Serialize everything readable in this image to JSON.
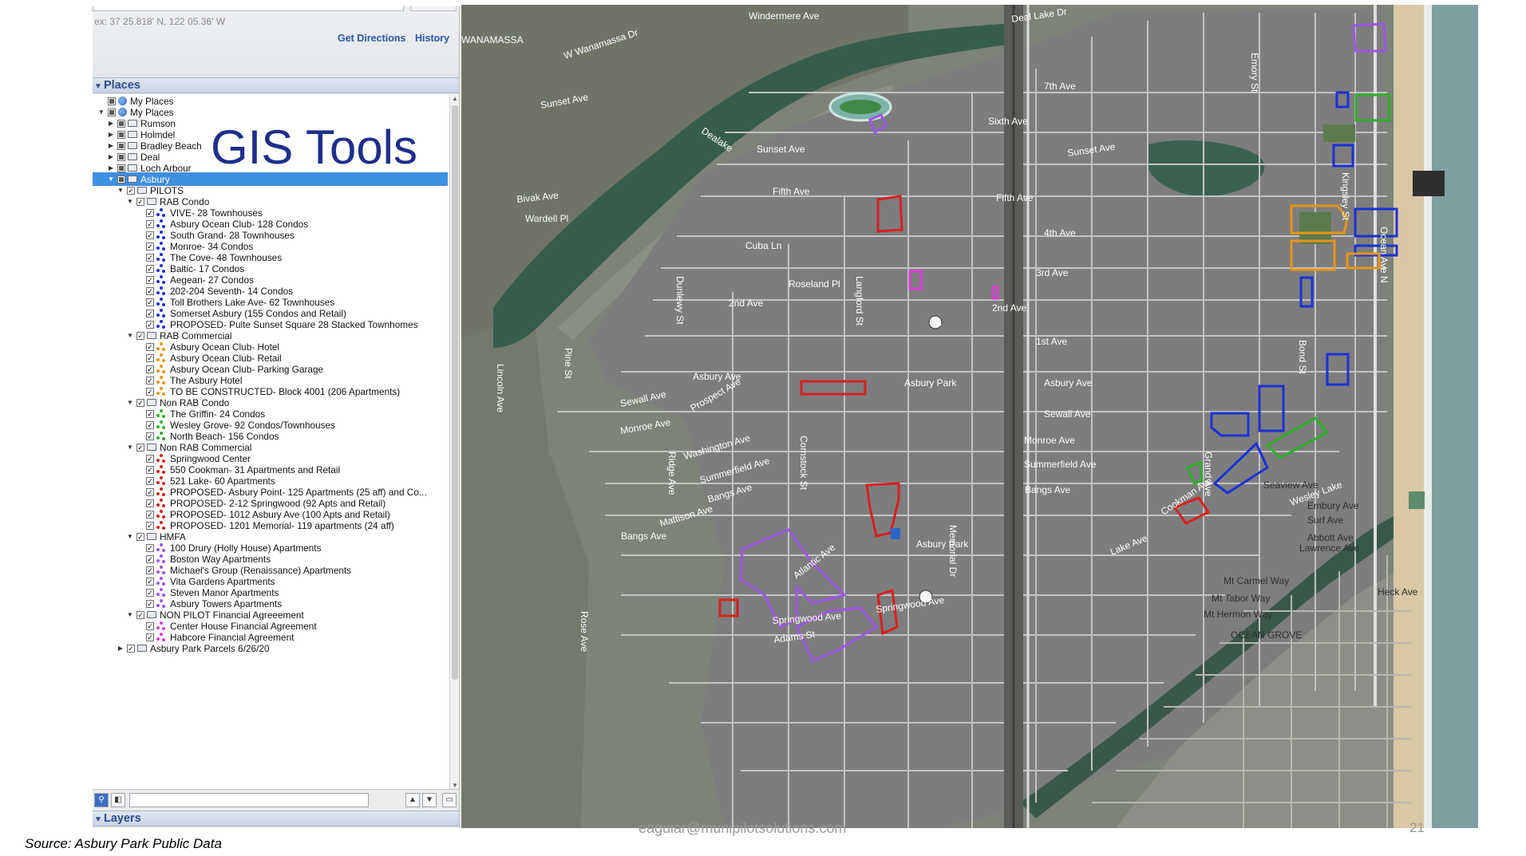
{
  "search": {
    "coords": "ex: 37 25.818' N, 122 05.36' W",
    "get_directions": "Get Directions",
    "history": "History"
  },
  "places": {
    "header": "Places",
    "items": [
      {
        "label": "My Places",
        "depth": 1,
        "icon": "globe",
        "expander": ""
      },
      {
        "label": "My Places",
        "depth": 1,
        "icon": "globe",
        "expander": "▼"
      },
      {
        "label": "Rumson",
        "depth": 2,
        "icon": "folder",
        "expander": "▶"
      },
      {
        "label": "Holmdel",
        "depth": 2,
        "icon": "folder",
        "expander": "▶"
      },
      {
        "label": "Bradley Beach",
        "depth": 2,
        "icon": "folder",
        "expander": "▶"
      },
      {
        "label": "Deal",
        "depth": 2,
        "icon": "folder",
        "expander": "▶"
      },
      {
        "label": "Loch Arbour",
        "depth": 2,
        "icon": "folder",
        "expander": "▶"
      },
      {
        "label": "Asbury",
        "depth": 2,
        "icon": "folder",
        "expander": "▼",
        "selected": true
      },
      {
        "label": "PILOTS",
        "depth": 3,
        "icon": "folder",
        "expander": "▼"
      },
      {
        "label": "RAB Condo",
        "depth": 4,
        "icon": "folder",
        "expander": "▼"
      },
      {
        "label": "VIVE- 28 Townhouses",
        "depth": 5,
        "icon": "pins",
        "color": "#1d2fd8"
      },
      {
        "label": "Asbury Ocean Club- 128 Condos",
        "depth": 5,
        "icon": "pins",
        "color": "#1d2fd8"
      },
      {
        "label": "South Grand- 28 Townhouses",
        "depth": 5,
        "icon": "pins",
        "color": "#1d2fd8"
      },
      {
        "label": "Monroe- 34 Condos",
        "depth": 5,
        "icon": "pins",
        "color": "#1d2fd8"
      },
      {
        "label": "The Cove- 48 Townhouses",
        "depth": 5,
        "icon": "pins",
        "color": "#1d2fd8"
      },
      {
        "label": "Baltic- 17 Condos",
        "depth": 5,
        "icon": "pins",
        "color": "#1d2fd8"
      },
      {
        "label": "Aegean- 27 Condos",
        "depth": 5,
        "icon": "pins",
        "color": "#1d2fd8"
      },
      {
        "label": "202-204 Seventh- 14 Condos",
        "depth": 5,
        "icon": "pins",
        "color": "#1d2fd8"
      },
      {
        "label": "Toll Brothers Lake Ave- 62 Townhouses",
        "depth": 5,
        "icon": "pins",
        "color": "#1d2fd8"
      },
      {
        "label": "Somerset Asbury (155 Condos and Retail)",
        "depth": 5,
        "icon": "pins",
        "color": "#1d2fd8"
      },
      {
        "label": "PROPOSED- Pulte Sunset Square 28 Stacked Townhomes",
        "depth": 5,
        "icon": "pins",
        "color": "#1d2fd8"
      },
      {
        "label": "RAB Commercial",
        "depth": 4,
        "icon": "folder",
        "expander": "▼"
      },
      {
        "label": "Asbury Ocean Club- Hotel",
        "depth": 5,
        "icon": "pins",
        "color": "#e69512"
      },
      {
        "label": "Asbury Ocean Club- Retail",
        "depth": 5,
        "icon": "pins",
        "color": "#e69512"
      },
      {
        "label": "Asbury Ocean Club- Parking Garage",
        "depth": 5,
        "icon": "pins",
        "color": "#e69512"
      },
      {
        "label": "The Asbury Hotel",
        "depth": 5,
        "icon": "pins",
        "color": "#e69512"
      },
      {
        "label": "TO BE CONSTRUCTED- Block 4001 (206 Apartments)",
        "depth": 5,
        "icon": "pins",
        "color": "#e69512"
      },
      {
        "label": "Non RAB Condo",
        "depth": 4,
        "icon": "folder",
        "expander": "▼"
      },
      {
        "label": "The Griffin- 24 Condos",
        "depth": 5,
        "icon": "pins",
        "color": "#2fae2a"
      },
      {
        "label": "Wesley Grove- 92 Condos/Townhouses",
        "depth": 5,
        "icon": "pins",
        "color": "#2fae2a"
      },
      {
        "label": "North Beach- 156 Condos",
        "depth": 5,
        "icon": "pins",
        "color": "#2fae2a"
      },
      {
        "label": "Non RAB Commercial",
        "depth": 4,
        "icon": "folder",
        "expander": "▼"
      },
      {
        "label": "Springwood Center",
        "depth": 5,
        "icon": "pins",
        "color": "#d8201f"
      },
      {
        "label": "550 Cookman- 31 Apartments and Retail",
        "depth": 5,
        "icon": "pins",
        "color": "#d8201f"
      },
      {
        "label": "521 Lake- 60 Apartments",
        "depth": 5,
        "icon": "pins",
        "color": "#d8201f"
      },
      {
        "label": "PROPOSED- Asbury Point- 125 Apartments (25 aff) and Co...",
        "depth": 5,
        "icon": "pins",
        "color": "#d8201f"
      },
      {
        "label": "PROPOSED- 2-12 Springwood (92 Apts and Retail)",
        "depth": 5,
        "icon": "pins",
        "color": "#d8201f"
      },
      {
        "label": "PROPOSED- 1012 Asbury Ave (100 Apts and Retail)",
        "depth": 5,
        "icon": "pins",
        "color": "#d8201f"
      },
      {
        "label": "PROPOSED- 1201 Memorial- 119 apartments (24 aff)",
        "depth": 5,
        "icon": "pins",
        "color": "#d8201f"
      },
      {
        "label": "HMFA",
        "depth": 4,
        "icon": "folder",
        "expander": "▼"
      },
      {
        "label": "100 Drury (Holly House) Apartments",
        "depth": 5,
        "icon": "pins",
        "color": "#9b57e0"
      },
      {
        "label": "Boston Way Apartments",
        "depth": 5,
        "icon": "pins",
        "color": "#9b57e0"
      },
      {
        "label": "Michael's Group (Renaissance) Apartments",
        "depth": 5,
        "icon": "pins",
        "color": "#9b57e0"
      },
      {
        "label": "Vita Gardens Apartments",
        "depth": 5,
        "icon": "pins",
        "color": "#9b57e0"
      },
      {
        "label": "Steven Manor Apartments",
        "depth": 5,
        "icon": "pins",
        "color": "#9b57e0"
      },
      {
        "label": "Asbury Towers Apartments",
        "depth": 5,
        "icon": "pins",
        "color": "#9b57e0"
      },
      {
        "label": "NON PILOT Financial Agreeement",
        "depth": 4,
        "icon": "folder",
        "expander": "▼"
      },
      {
        "label": "Center House Financial Agreement",
        "depth": 5,
        "icon": "pins",
        "color": "#d93ed6"
      },
      {
        "label": "Habcore Financial Agreement",
        "depth": 5,
        "icon": "pins",
        "color": "#d93ed6"
      },
      {
        "label": "Asbury Park Parcels 6/26/20",
        "depth": 3,
        "icon": "folder",
        "expander": "▶"
      }
    ]
  },
  "layers": {
    "header": "Layers"
  },
  "overlay_title": "GIS Tools",
  "map": {
    "labels": [
      {
        "text": "Windermere Ave",
        "dark": false
      },
      {
        "text": "Deal Lake Dr",
        "dark": false
      },
      {
        "text": "WANAMASSA",
        "dark": false
      },
      {
        "text": "W Wanamassa Dr",
        "dark": false
      },
      {
        "text": "7th Ave",
        "dark": false
      },
      {
        "text": "Sunset Ave",
        "dark": false
      },
      {
        "text": "Sixth Ave",
        "dark": false
      },
      {
        "text": "Sunset Ave",
        "dark": false
      },
      {
        "text": "Sunset Ave",
        "dark": false
      },
      {
        "text": "Dealake",
        "dark": false
      },
      {
        "text": "Fifth Ave",
        "dark": false
      },
      {
        "text": "Fifth Ave",
        "dark": false
      },
      {
        "text": "Bivak Ave",
        "dark": false
      },
      {
        "text": "Wardell Pl",
        "dark": false
      },
      {
        "text": "4th Ave",
        "dark": false
      },
      {
        "text": "Cuba Ln",
        "dark": false
      },
      {
        "text": "3rd Ave",
        "dark": false
      },
      {
        "text": "Roseland Pl",
        "dark": false
      },
      {
        "text": "2nd Ave",
        "dark": false
      },
      {
        "text": "2nd Ave",
        "dark": false
      },
      {
        "text": "1st Ave",
        "dark": false
      },
      {
        "text": "Asbury Ave",
        "dark": false
      },
      {
        "text": "Asbury Park",
        "dark": false
      },
      {
        "text": "Asbury Ave",
        "dark": false
      },
      {
        "text": "Sewall Ave",
        "dark": false
      },
      {
        "text": "Sewall Ave",
        "dark": false
      },
      {
        "text": "Monroe Ave",
        "dark": false
      },
      {
        "text": "Monroe Ave",
        "dark": false
      },
      {
        "text": "Prospect Ave",
        "dark": false
      },
      {
        "text": "Washington Ave",
        "dark": false
      },
      {
        "text": "Summerfield Ave",
        "dark": false
      },
      {
        "text": "Summerfield Ave",
        "dark": false
      },
      {
        "text": "Bangs Ave",
        "dark": false
      },
      {
        "text": "Bangs Ave",
        "dark": false
      },
      {
        "text": "Bangs Ave",
        "dark": false
      },
      {
        "text": "Mattison Ave",
        "dark": false
      },
      {
        "text": "Cookman Ave",
        "dark": false
      },
      {
        "text": "Asbury Park",
        "dark": false
      },
      {
        "text": "Lake Ave",
        "dark": false
      },
      {
        "text": "Wesley Lake",
        "dark": false
      },
      {
        "text": "Atlantic Ave",
        "dark": false
      },
      {
        "text": "Springwood Ave",
        "dark": false
      },
      {
        "text": "Springwood Ave",
        "dark": false
      },
      {
        "text": "Adams St",
        "dark": false
      },
      {
        "text": "Seaview Ave",
        "dark": true
      },
      {
        "text": "Embury Ave",
        "dark": true
      },
      {
        "text": "Surf Ave",
        "dark": true
      },
      {
        "text": "Abbott Ave",
        "dark": true
      },
      {
        "text": "Lawrence Ave",
        "dark": true
      },
      {
        "text": "Heck Ave",
        "dark": true
      },
      {
        "text": "Mt Carmel Way",
        "dark": true
      },
      {
        "text": "Mt Tabor Way",
        "dark": true
      },
      {
        "text": "Mt Hermon Way",
        "dark": true
      },
      {
        "text": "OCEAN GROVE",
        "dark": true
      },
      {
        "text": "71",
        "dark": false
      },
      {
        "text": "71",
        "dark": false
      },
      {
        "text": "Memorial Dr",
        "dark": false
      },
      {
        "text": "Ocean Ave N",
        "dark": false
      },
      {
        "text": "Kingsley St",
        "dark": false
      },
      {
        "text": "Grand Ave",
        "dark": false
      },
      {
        "text": "Emory St",
        "dark": false
      },
      {
        "text": "Bond St",
        "dark": false
      },
      {
        "text": "Langford St",
        "dark": false
      },
      {
        "text": "Comstock St",
        "dark": false
      },
      {
        "text": "Ridge Ave",
        "dark": false
      },
      {
        "text": "Dunlewy St",
        "dark": false
      },
      {
        "text": "Lincoln Ave",
        "dark": false
      },
      {
        "text": "Rose Ave",
        "dark": false
      },
      {
        "text": "Pine St",
        "dark": false
      }
    ]
  },
  "footer": {
    "source": "Source: Asbury Park Public Data",
    "email": "eaguiar@munipilotsolutions.com",
    "page": "21"
  },
  "colors": {
    "rab_condo": "#1d2fd8",
    "rab_commercial": "#e69512",
    "non_rab_condo": "#2fae2a",
    "non_rab_commercial": "#d8201f",
    "hmfa": "#9b57e0",
    "non_pilot": "#d93ed6",
    "title": "#1f2e8a"
  }
}
